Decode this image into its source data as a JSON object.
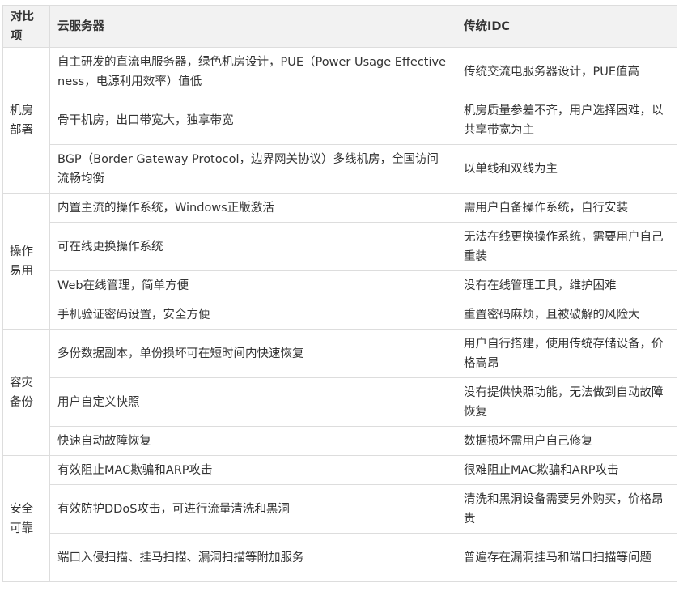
{
  "table": {
    "headers": [
      "对比项",
      "云服务器",
      "传统IDC"
    ],
    "groups": [
      {
        "category": "机房部署",
        "rows": [
          [
            "自主研发的直流电服务器，绿色机房设计，PUE（Power Usage Effectiveness，电源利用效率）值低",
            "传统交流电服务器设计，PUE值高"
          ],
          [
            "骨干机房，出口带宽大，独享带宽",
            "机房质量参差不齐，用户选择困难，以共享带宽为主"
          ],
          [
            "BGP（Border Gateway Protocol，边界网关协议）多线机房，全国访问流畅均衡",
            "以单线和双线为主"
          ]
        ]
      },
      {
        "category": "操作易用",
        "rows": [
          [
            "内置主流的操作系统，Windows正版激活",
            "需用户自备操作系统，自行安装"
          ],
          [
            "可在线更换操作系统",
            "无法在线更换操作系统，需要用户自己重装"
          ],
          [
            "Web在线管理，简单方便",
            "没有在线管理工具，维护困难"
          ],
          [
            "手机验证密码设置，安全方便",
            "重置密码麻烦，且被破解的风险大"
          ]
        ]
      },
      {
        "category": "容灾备份",
        "rows": [
          [
            "多份数据副本，单份损坏可在短时间内快速恢复",
            "用户自行搭建，使用传统存储设备，价格高昂"
          ],
          [
            "用户自定义快照",
            "没有提供快照功能，无法做到自动故障恢复"
          ],
          [
            "快速自动故障恢复",
            "数据损坏需用户自己修复"
          ]
        ]
      },
      {
        "category": "安全可靠",
        "rows": [
          [
            "有效阻止MAC欺骗和ARP攻击",
            "很难阻止MAC欺骗和ARP攻击"
          ],
          [
            "有效防护DDoS攻击，可进行流量清洗和黑洞",
            "清洗和黑洞设备需要另外购买，价格昂贵"
          ],
          [
            "端口入侵扫描、挂马扫描、漏洞扫描等附加服务",
            "普遍存在漏洞挂马和端口扫描等问题"
          ]
        ]
      }
    ]
  }
}
